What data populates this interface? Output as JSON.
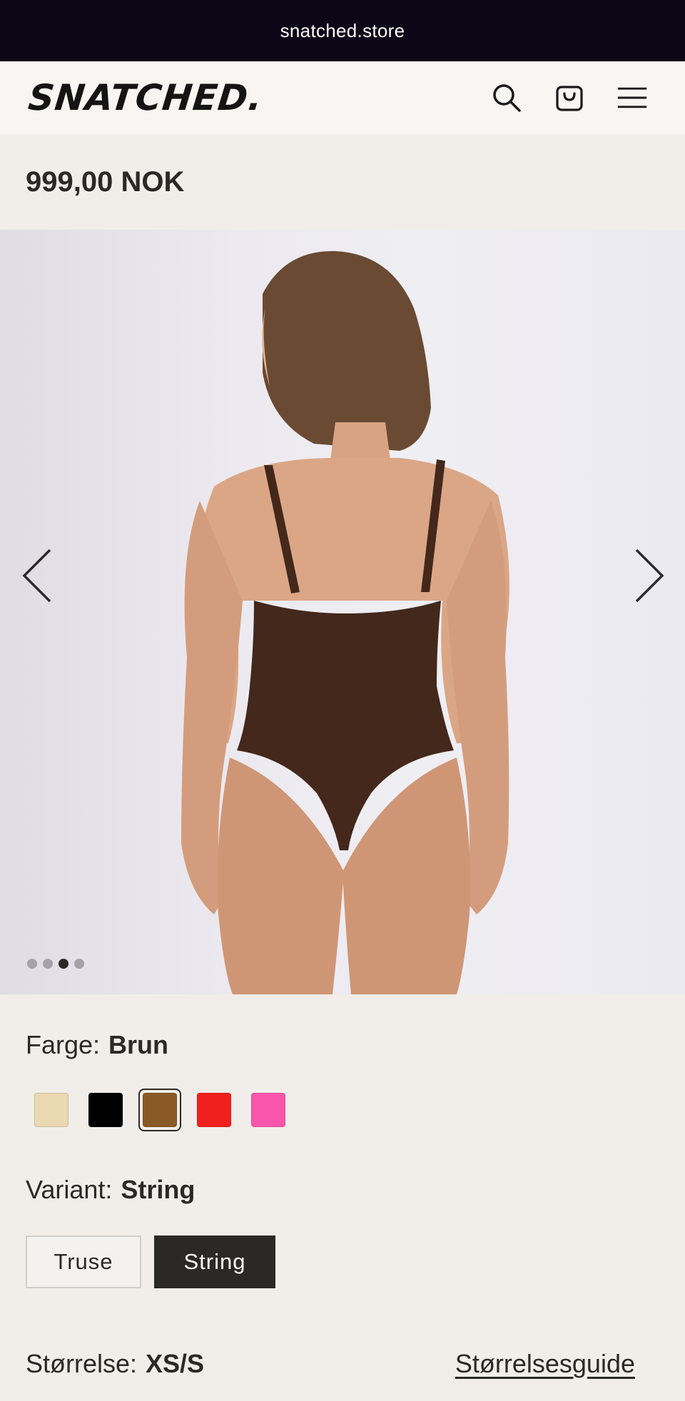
{
  "browser": {
    "url": "snatched.store"
  },
  "header": {
    "logo": "SNATCHED.",
    "icons": [
      "search-icon",
      "cart-icon",
      "menu-icon"
    ]
  },
  "product": {
    "price": "999,00 NOK"
  },
  "gallery": {
    "image_alt": "Model wearing brown string bodysuit, back view",
    "dot_count": 4,
    "active_dot_index": 2
  },
  "color": {
    "label": "Farge:",
    "selected": "Brun",
    "swatches": [
      {
        "name": "Beige",
        "hex": "#ead9b3"
      },
      {
        "name": "Svart",
        "hex": "#000000"
      },
      {
        "name": "Brun",
        "hex": "#8a5a26",
        "selected": true
      },
      {
        "name": "Rød",
        "hex": "#f0201e"
      },
      {
        "name": "Rosa",
        "hex": "#fa55ad"
      }
    ]
  },
  "variant": {
    "label": "Variant:",
    "selected": "String",
    "options": [
      "Truse",
      "String"
    ]
  },
  "size": {
    "label": "Størrelse:",
    "selected": "XS/S",
    "guide_link": "Størrelsesguide"
  }
}
